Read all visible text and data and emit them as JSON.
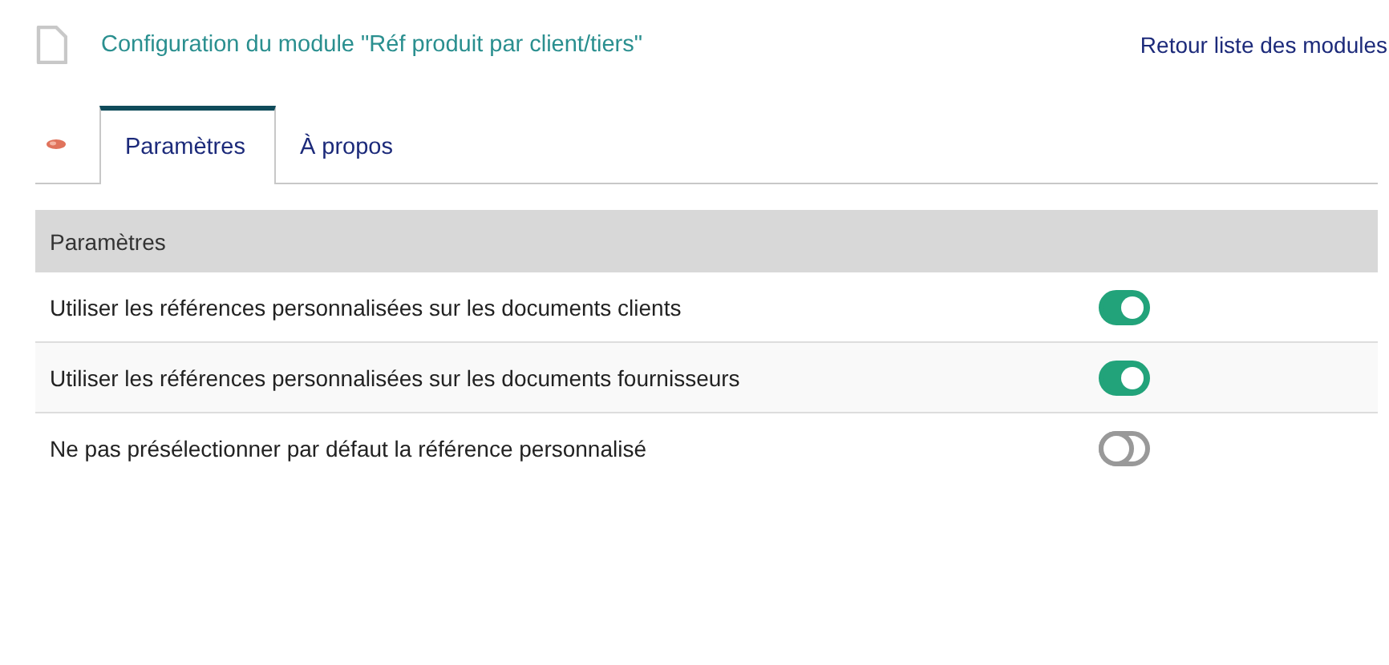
{
  "header": {
    "title": "Configuration du module \"Réf produit par client/tiers\"",
    "back_link": "Retour liste des modules"
  },
  "tabs": [
    {
      "label": "Paramètres",
      "selected": true
    },
    {
      "label": "À propos",
      "selected": false
    }
  ],
  "table": {
    "heading": "Paramètres",
    "rows": [
      {
        "label": "Utiliser les références personnalisées sur les documents clients",
        "on": true
      },
      {
        "label": "Utiliser les références personnalisées sur les documents fournisseurs",
        "on": true
      },
      {
        "label": "Ne pas présélectionner par défaut la référence personnalisé",
        "on": false
      }
    ]
  }
}
